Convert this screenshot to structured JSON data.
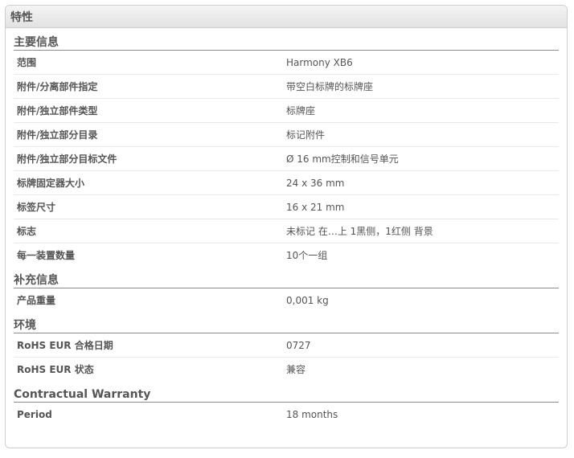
{
  "panel": {
    "title": "特性"
  },
  "sections": {
    "main": {
      "title": "主要信息",
      "rows": [
        {
          "label": "范围",
          "value": "Harmony XB6"
        },
        {
          "label": "附件/分离部件指定",
          "value": "带空白标牌的标牌座"
        },
        {
          "label": "附件/独立部件类型",
          "value": "标牌座"
        },
        {
          "label": "附件/独立部分目录",
          "value": "标记附件"
        },
        {
          "label": "附件/独立部分目标文件",
          "value": "Ø 16 mm控制和信号单元"
        },
        {
          "label": "标牌固定器大小",
          "value": "24 x 36 mm"
        },
        {
          "label": "标签尺寸",
          "value": "16 x 21 mm"
        },
        {
          "label": "标志",
          "value": "未标记 在…上 1黑侧，1红侧 背景"
        },
        {
          "label": "每一装置数量",
          "value": "10个一组"
        }
      ]
    },
    "supplementary": {
      "title": "补充信息",
      "rows": [
        {
          "label": "产品重量",
          "value": "0,001 kg"
        }
      ]
    },
    "environment": {
      "title": "环境",
      "rows": [
        {
          "label": "RoHS EUR 合格日期",
          "value": "0727"
        },
        {
          "label": "RoHS EUR 状态",
          "value": "兼容"
        }
      ]
    },
    "warranty": {
      "title": "Contractual Warranty",
      "rows": [
        {
          "label": "Period",
          "value": "18 months"
        }
      ]
    }
  }
}
